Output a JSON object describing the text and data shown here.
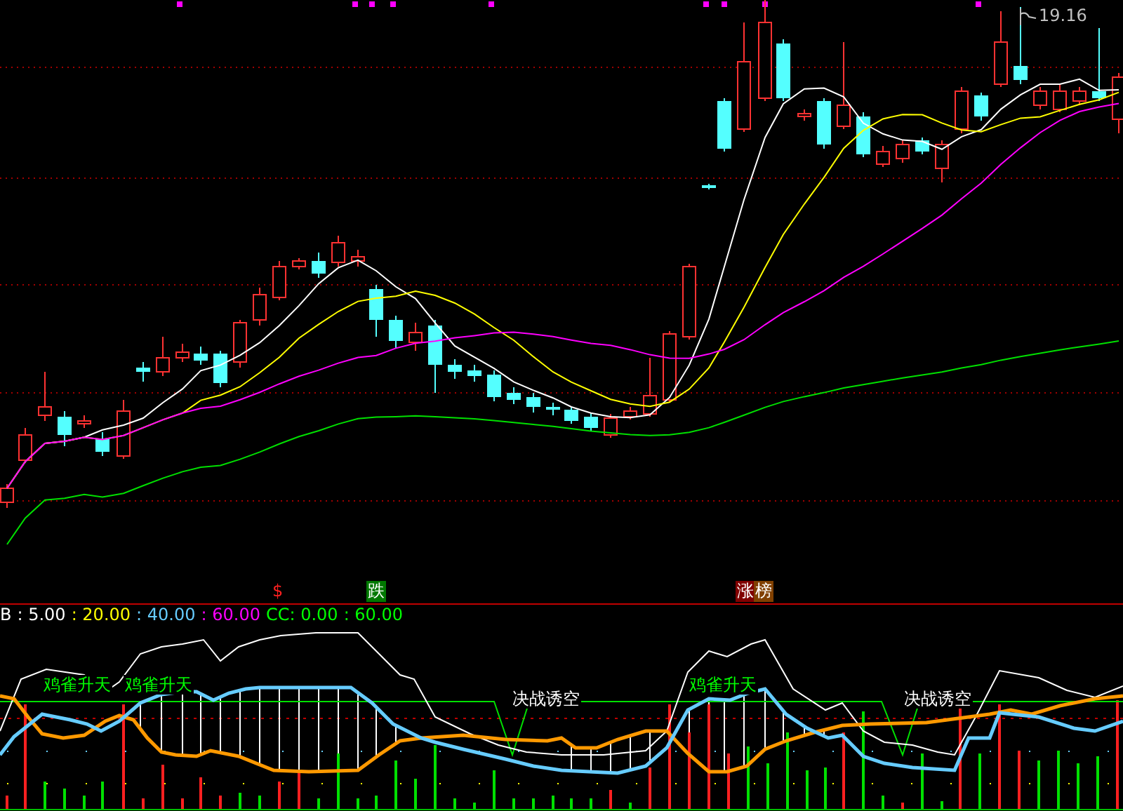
{
  "price_label": "19.16",
  "markers": [
    {
      "text": "$",
      "kind": "dollar"
    },
    {
      "text": "跌",
      "kind": "fall"
    },
    {
      "text": "涨",
      "kind": "rise"
    },
    {
      "text": "榜",
      "kind": "board"
    }
  ],
  "indicator_header": [
    {
      "text": "B",
      "color": "#ffffff"
    },
    {
      "text": ": 5.00",
      "color": "#ffffff"
    },
    {
      "text": ": 20.00",
      "color": "#ffff00"
    },
    {
      "text": ": 40.00",
      "color": "#66ccff"
    },
    {
      "text": ": 60.00",
      "color": "#ff00ff"
    },
    {
      "text": "CC: 0.00",
      "color": "#00ff00"
    },
    {
      "text": ": 60.00",
      "color": "#00ff00"
    }
  ],
  "signals": [
    {
      "text": "鸡雀升天",
      "kind": "buy"
    },
    {
      "text": "鸡雀升天",
      "kind": "buy"
    },
    {
      "text": "决战诱空",
      "kind": "sell"
    },
    {
      "text": "鸡雀升天",
      "kind": "buy"
    },
    {
      "text": "决战诱空",
      "kind": "sell"
    }
  ]
}
